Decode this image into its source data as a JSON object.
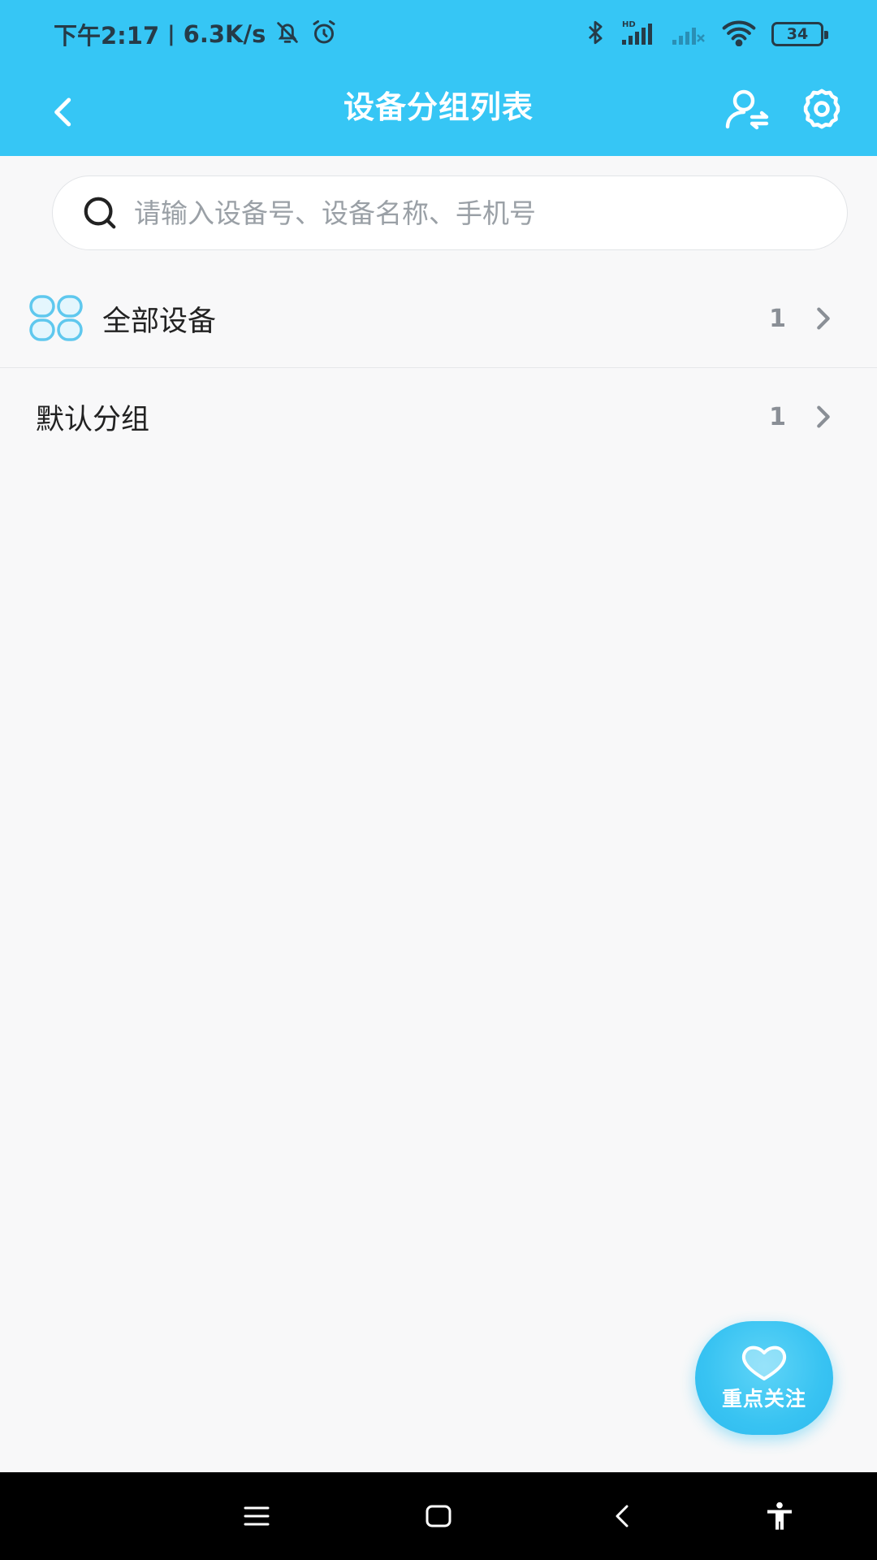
{
  "status_bar": {
    "time": "下午2:17",
    "separator": "|",
    "net_speed": "6.3K/s",
    "battery": "34",
    "icons": [
      "bell-off-icon",
      "alarm-icon",
      "bluetooth-icon",
      "signal-hd-icon",
      "signal-x-icon",
      "wifi-icon",
      "battery-icon"
    ]
  },
  "toolbar": {
    "title": "设备分组列表",
    "icons": [
      "back-arrow-icon",
      "user-switch-icon",
      "gear-icon"
    ]
  },
  "search": {
    "placeholder": "请输入设备号、设备名称、手机号",
    "value": ""
  },
  "groups": [
    {
      "label": "全部设备",
      "count": "1",
      "icon": "grid-four-icon"
    },
    {
      "label": "默认分组",
      "count": "1"
    }
  ],
  "fab": {
    "label": "重点关注",
    "icon": "heart-icon"
  },
  "nav_bar": {
    "icons": [
      "menu-icon",
      "home-square-icon",
      "back-icon",
      "accessibility-icon"
    ]
  },
  "colors": {
    "primary": "#36c6f5",
    "background": "#f8f8f9",
    "nav": "#000000"
  }
}
